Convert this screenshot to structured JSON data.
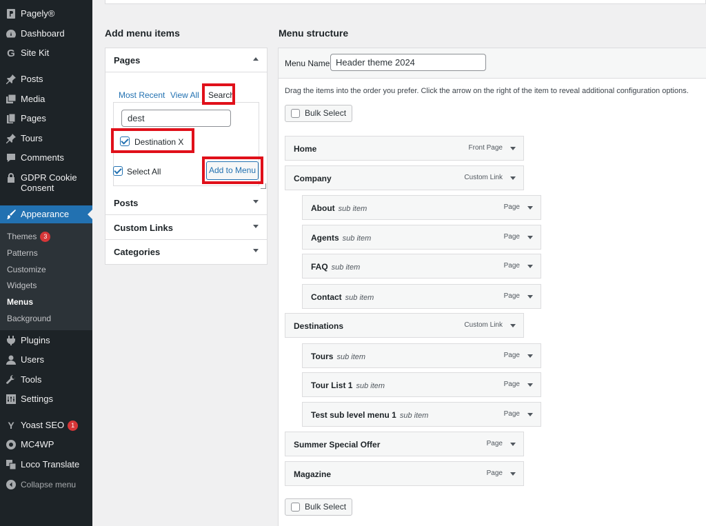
{
  "sidebar": {
    "items": [
      {
        "label": "Pagely®",
        "icon": "pagely-icon"
      },
      {
        "label": "Dashboard",
        "icon": "dashboard-icon"
      },
      {
        "label": "Site Kit",
        "icon": "google-icon"
      },
      {
        "label": "Posts",
        "icon": "pin-icon"
      },
      {
        "label": "Media",
        "icon": "media-icon"
      },
      {
        "label": "Pages",
        "icon": "pages-icon"
      },
      {
        "label": "Tours",
        "icon": "pin-icon"
      },
      {
        "label": "Comments",
        "icon": "comment-icon"
      },
      {
        "label": "GDPR Cookie Consent",
        "icon": "lock-icon"
      },
      {
        "label": "Appearance",
        "icon": "brush-icon"
      },
      {
        "label": "Plugins",
        "icon": "plugin-icon"
      },
      {
        "label": "Users",
        "icon": "user-icon"
      },
      {
        "label": "Tools",
        "icon": "wrench-icon"
      },
      {
        "label": "Settings",
        "icon": "settings-icon"
      },
      {
        "label": "Yoast SEO",
        "icon": "yoast-icon",
        "badge": "1"
      },
      {
        "label": "MC4WP",
        "icon": "mc4wp-icon"
      },
      {
        "label": "Loco Translate",
        "icon": "translate-icon"
      },
      {
        "label": "Collapse menu",
        "icon": "collapse-icon"
      }
    ],
    "submenu": [
      {
        "label": "Themes",
        "badge": "3"
      },
      {
        "label": "Patterns"
      },
      {
        "label": "Customize"
      },
      {
        "label": "Widgets"
      },
      {
        "label": "Menus",
        "current": true
      },
      {
        "label": "Background"
      }
    ]
  },
  "add_items": {
    "heading": "Add menu items",
    "pages_title": "Pages",
    "tabs": [
      "Most Recent",
      "View All",
      "Search"
    ],
    "search_value": "dest",
    "result": "Destination X",
    "select_all": "Select All",
    "add_button": "Add to Menu",
    "sections": [
      "Posts",
      "Custom Links",
      "Categories"
    ]
  },
  "structure": {
    "heading": "Menu structure",
    "menu_name_label": "Menu Name",
    "menu_name_value": "Header theme 2024",
    "instructions": "Drag the items into the order you prefer. Click the arrow on the right of the item to reveal additional configuration options.",
    "bulk_select": "Bulk Select",
    "items": [
      {
        "title": "Home",
        "type": "Front Page",
        "sub": false
      },
      {
        "title": "Company",
        "type": "Custom Link",
        "sub": false
      },
      {
        "title": "About",
        "type": "Page",
        "sub": true,
        "sub_label": "sub item"
      },
      {
        "title": "Agents",
        "type": "Page",
        "sub": true,
        "sub_label": "sub item"
      },
      {
        "title": "FAQ",
        "type": "Page",
        "sub": true,
        "sub_label": "sub item"
      },
      {
        "title": "Contact",
        "type": "Page",
        "sub": true,
        "sub_label": "sub item"
      },
      {
        "title": "Destinations",
        "type": "Custom Link",
        "sub": false
      },
      {
        "title": "Tours",
        "type": "Page",
        "sub": true,
        "sub_label": "sub item"
      },
      {
        "title": "Tour List 1",
        "type": "Page",
        "sub": true,
        "sub_label": "sub item"
      },
      {
        "title": "Test sub level menu 1",
        "type": "Page",
        "sub": true,
        "sub_label": "sub item"
      },
      {
        "title": "Summer Special Offer",
        "type": "Page",
        "sub": false
      },
      {
        "title": "Magazine",
        "type": "Page",
        "sub": false
      }
    ]
  },
  "colors": {
    "sidebar": "#1d2327",
    "accent": "#2271b1",
    "highlight": "#e0101a"
  }
}
